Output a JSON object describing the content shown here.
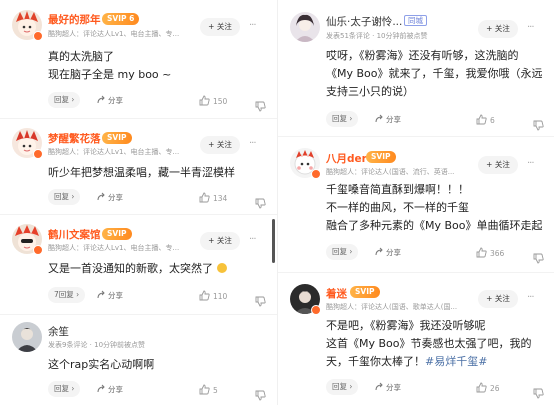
{
  "common": {
    "follow_label": "+ 关注",
    "reply_label": "回复",
    "share_label": "分享",
    "more_label": "···"
  },
  "left": [
    {
      "username": "最好的那年",
      "badge": "SVIP 6",
      "meta": "酷狗超人：评论达人Lv1、电台主播、专...",
      "lines": [
        "真的太洗脑了",
        "现在脑子全是 my boo ~"
      ],
      "reply_count": "",
      "likes": "150"
    },
    {
      "username": "梦醒繁花落",
      "badge": "SVIP",
      "meta": "酷狗超人：评论达人Lv1、电台主播、专...",
      "lines": [
        "听少年把梦想温柔唱，藏一半青涩模样"
      ],
      "reply_count": "",
      "likes": "134"
    },
    {
      "username": "鹤川文案馆",
      "badge": "SVIP",
      "meta": "酷狗超人：评论达人Lv1、电台主播、专...",
      "lines": [
        "又是一首没通知的新歌，太突然了"
      ],
      "reply_count": "7",
      "likes": "110"
    },
    {
      "username": "余笙",
      "badge": "",
      "meta": "发表9条评论 · 10分钟前被点赞",
      "lines": [
        "这个rap实名心动啊啊"
      ],
      "reply_count": "",
      "likes": "5"
    }
  ],
  "right": [
    {
      "username": "仙乐·太子谢怜...",
      "badge": "同城",
      "meta": "发表51条评论 · 10分钟前被点赞",
      "lines": [
        "哎呀，《粉雾海》还没有听够，这洗脑的",
        "《My Boo》就来了，千玺，我爱你哦（永远",
        "支持三小只的说）"
      ],
      "reply_count": "",
      "likes": "6"
    },
    {
      "username": "八月der",
      "badge": "SVIP",
      "meta": "酷狗超人：评论达人(国语、流行、英语...",
      "lines": [
        "千玺嗓音简直酥到爆啊！！！",
        "不一样的曲风，不一样的千玺",
        "融合了多种元素的《My Boo》单曲循环走起"
      ],
      "reply_count": "",
      "likes": "366"
    },
    {
      "username": "着迷",
      "badge": "SVIP",
      "meta": "酷狗超人：评论达人(国语、歌单达人(国...",
      "lines": [
        "不是吧，《粉雾海》我还没听够呢",
        "这首《My Boo》节奏感也太强了吧，我的",
        "天，千玺你太棒了！"
      ],
      "hashtag": "#易烊千玺#",
      "reply_count": "",
      "likes": "26"
    }
  ],
  "colors": {
    "vip_name": "#ff5a1f",
    "badge": "#ff8a1f",
    "hashtag": "#4a6fa5"
  }
}
